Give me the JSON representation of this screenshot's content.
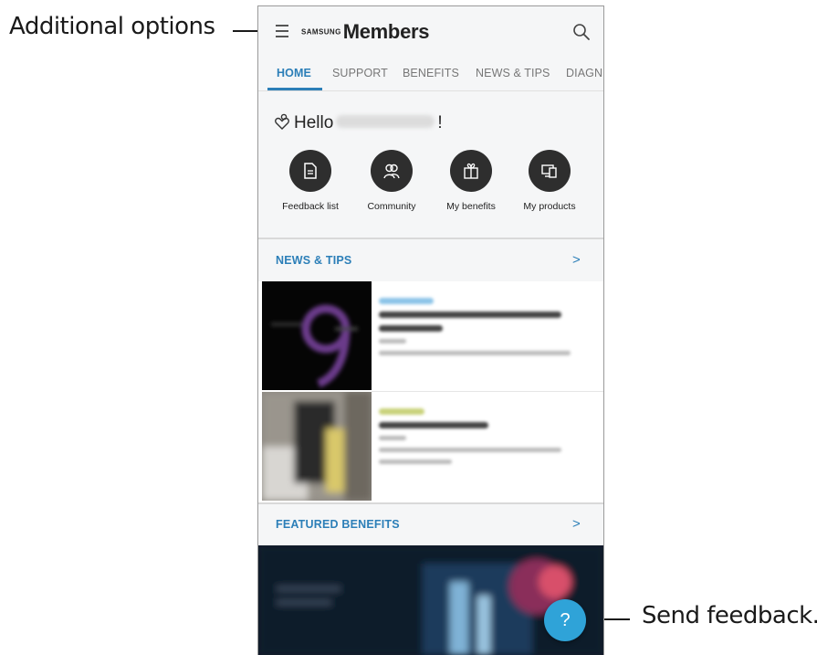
{
  "callouts": {
    "additional_options": "Additional options",
    "send_feedback": "Send feedback."
  },
  "app": {
    "brand_small": "SAMSUNG",
    "brand_big": "Members"
  },
  "tabs": [
    {
      "label": "HOME",
      "active": true
    },
    {
      "label": "SUPPORT"
    },
    {
      "label": "BENEFITS"
    },
    {
      "label": "NEWS & TIPS"
    },
    {
      "label": "DIAGN"
    }
  ],
  "greeting": {
    "hello": "Hello",
    "suffix": "!"
  },
  "quick_actions": [
    {
      "label": "Feedback list",
      "icon": "document-icon"
    },
    {
      "label": "Community",
      "icon": "people-icon"
    },
    {
      "label": "My benefits",
      "icon": "gift-icon"
    },
    {
      "label": "My products",
      "icon": "devices-icon"
    }
  ],
  "sections": {
    "news_tips": {
      "title": "NEWS & TIPS",
      "chevron": ">"
    },
    "featured_benefits": {
      "title": "FEATURED BENEFITS",
      "chevron": ">"
    }
  },
  "fab": {
    "label": "?"
  },
  "colors": {
    "accent": "#2c7fb8",
    "fab": "#2fa3d8",
    "icon_circle": "#2e2e2e",
    "background": "#f5f6f7"
  }
}
